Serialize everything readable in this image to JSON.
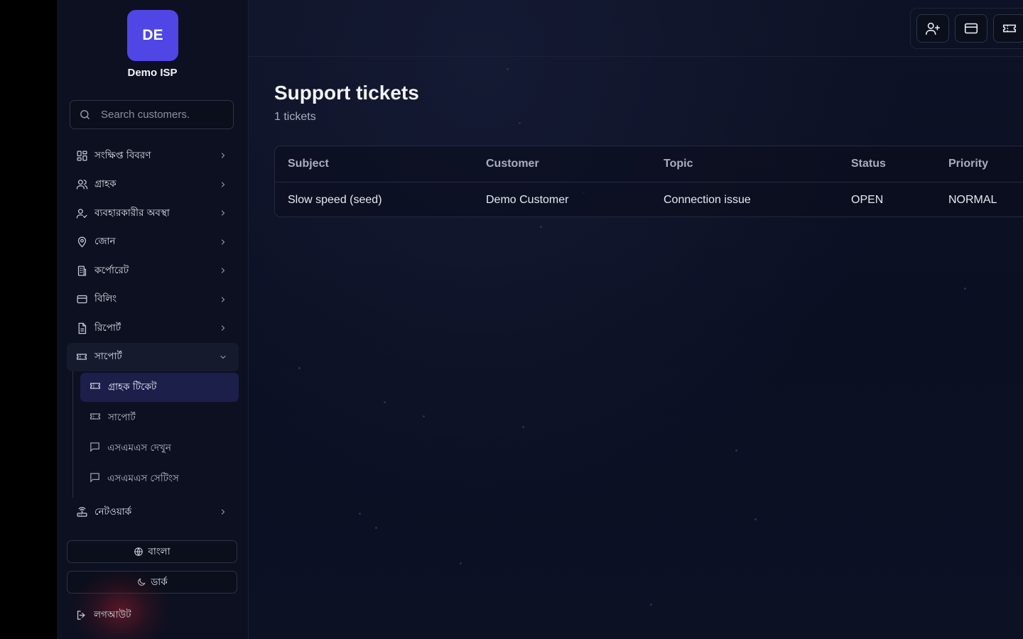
{
  "brand": {
    "initials": "DE",
    "name": "Demo ISP"
  },
  "search": {
    "placeholder": "Search customers."
  },
  "sidebar": {
    "items": [
      {
        "label": "সংক্ষিপ্ত বিবরণ",
        "icon": "dashboard-icon"
      },
      {
        "label": "গ্রাহক",
        "icon": "users-icon"
      },
      {
        "label": "ব্যবহারকারীর অবস্থা",
        "icon": "user-check-icon"
      },
      {
        "label": "জোন",
        "icon": "map-pin-icon"
      },
      {
        "label": "কর্পোরেট",
        "icon": "building-icon"
      },
      {
        "label": "বিলিং",
        "icon": "credit-card-icon"
      },
      {
        "label": "রিপোর্ট",
        "icon": "file-text-icon"
      },
      {
        "label": "সাপোর্ট",
        "icon": "ticket-icon",
        "expanded": true
      },
      {
        "label": "নেটওয়ার্ক",
        "icon": "router-icon"
      }
    ],
    "support_sub": [
      {
        "label": "গ্রাহক টিকেট",
        "icon": "ticket-icon",
        "active": true
      },
      {
        "label": "সাপোর্ট",
        "icon": "ticket-icon"
      },
      {
        "label": "এসএমএস দেখুন",
        "icon": "message-icon"
      },
      {
        "label": "এসএমএস সেটিংস",
        "icon": "message-icon"
      }
    ],
    "language_button": "বাংলা",
    "theme_button": "ডার্ক",
    "logout": "লগআউট"
  },
  "page": {
    "title": "Support tickets",
    "subtitle": "1 tickets"
  },
  "table": {
    "columns": [
      "Subject",
      "Customer",
      "Topic",
      "Status",
      "Priority"
    ],
    "rows": [
      [
        "Slow speed (seed)",
        "Demo Customer",
        "Connection issue",
        "OPEN",
        "NORMAL"
      ]
    ]
  },
  "colors": {
    "accent": "#4f46e5",
    "active_bg": "#1c1f4a",
    "sidebar_bg": "#0d1020",
    "main_bg": "#0e1226"
  }
}
